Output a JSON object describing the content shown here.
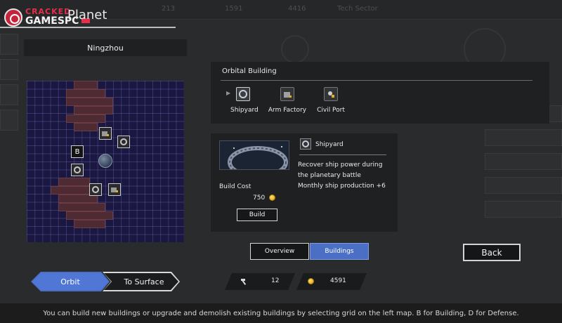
{
  "logo": {
    "line1": "CRACKED",
    "line2": "GAMESPC"
  },
  "header": {
    "title": "Planet"
  },
  "background": {
    "top_values": [
      "213",
      "1591",
      "4416"
    ],
    "top_label": "Tech Sector"
  },
  "planet": {
    "name": "Ningzhou"
  },
  "map": {
    "building_marker": "B"
  },
  "map_tabs": {
    "orbit": "Orbit",
    "surface": "To Surface"
  },
  "orbital": {
    "title": "Orbital Building",
    "items": [
      {
        "label": "Shipyard",
        "icon": "ring-station-icon",
        "selected": true
      },
      {
        "label": "Arm Factory",
        "icon": "factory-icon",
        "selected": false
      },
      {
        "label": "Civil Port",
        "icon": "port-icon",
        "selected": false
      }
    ]
  },
  "detail": {
    "name": "Shipyard",
    "desc_line1": "Recover ship power during",
    "desc_line2": "the planetary battle",
    "desc_line3": "Monthly ship production +6",
    "cost_label": "Build Cost",
    "cost_value": "750",
    "build_label": "Build"
  },
  "view_tabs": {
    "overview": "Overview",
    "buildings": "Buildings"
  },
  "back_label": "Back",
  "resources": {
    "hammer": "12",
    "gold": "4591"
  },
  "hint": "You can build new buildings or upgrade and demolish existing buildings by selecting grid on the left map. B for Building, D for Defense.",
  "colors": {
    "accent": "#4a6fc4",
    "panel": "#1f2021",
    "grid": "#1a1740",
    "rock": "#4e2a33"
  }
}
